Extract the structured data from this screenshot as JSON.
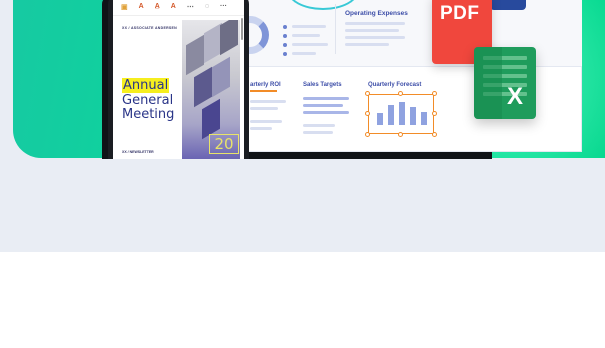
{
  "phone": {
    "doc_header": "XX / ASSOCIATE ANDERSEN",
    "title_lines": [
      "Annual",
      "General",
      "Meeting"
    ],
    "footer": "XX / NEWSLETTER",
    "badge": "20",
    "toolbar_icons": [
      "page-icon",
      "text-color-icon",
      "highlight-icon",
      "font-icon",
      "more-tools-icon",
      "comment-icon",
      "overflow-icon"
    ]
  },
  "dashboard": {
    "operating_expenses": "Operating Expenses",
    "quarterly_roi": "arterly ROI",
    "sales_targets": "Sales Targets",
    "quarterly_forecast": "Quarterly Forecast"
  },
  "file_icons": {
    "pdf_label": "PDF",
    "xls_label": "X"
  },
  "colors": {
    "hero_green": "#08d99a",
    "accent_orange": "#f28c28",
    "pdf_red": "#f0473d",
    "excel_green": "#1f9c5c",
    "word_blue": "#284a9d",
    "title_blue": "#2a3588",
    "highlight_yellow": "#f6ee1f"
  },
  "forecast_bars": [
    0.45,
    0.75,
    0.9,
    0.7,
    0.5
  ]
}
